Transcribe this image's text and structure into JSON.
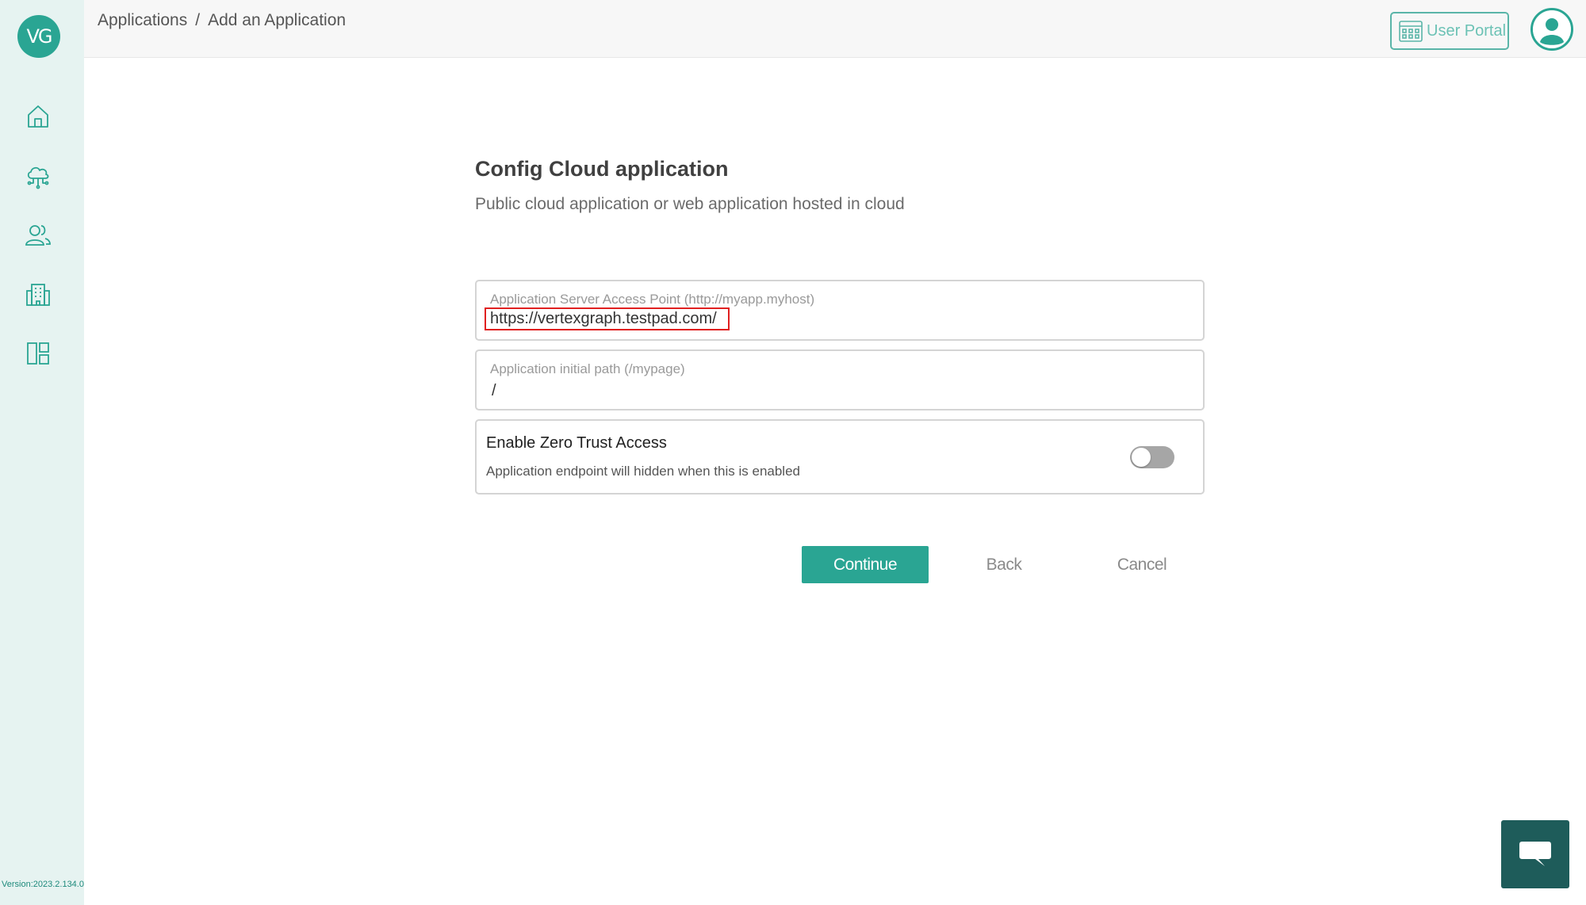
{
  "sidebar": {
    "logo_text": "VG",
    "items": [
      {
        "name": "home",
        "icon": "home-icon"
      },
      {
        "name": "cloud",
        "icon": "cloud-network-icon"
      },
      {
        "name": "users",
        "icon": "users-icon"
      },
      {
        "name": "buildings",
        "icon": "building-icon"
      },
      {
        "name": "layout",
        "icon": "layout-icon"
      }
    ],
    "version": "Version:2023.2.134.0"
  },
  "header": {
    "breadcrumb": [
      "Applications",
      "Add an Application"
    ],
    "breadcrumb_separator": "/",
    "user_portal_label": "User Portal"
  },
  "form": {
    "title": "Config Cloud application",
    "subtitle": "Public cloud application or web application hosted in cloud",
    "access_point": {
      "label": "Application Server Access Point (http://myapp.myhost)",
      "value": "https://vertexgraph.testpad.com/"
    },
    "initial_path": {
      "label": "Application initial path (/mypage)",
      "value": "/"
    },
    "zero_trust": {
      "title": "Enable Zero Trust Access",
      "description": "Application endpoint will hidden when this is enabled",
      "enabled": false
    }
  },
  "actions": {
    "continue_label": "Continue",
    "back_label": "Back",
    "cancel_label": "Cancel"
  },
  "colors": {
    "accent": "#2aa593",
    "sidebar_bg": "#e6f3f1",
    "highlight": "#e02020",
    "chat_bg": "#1e5c5a"
  }
}
